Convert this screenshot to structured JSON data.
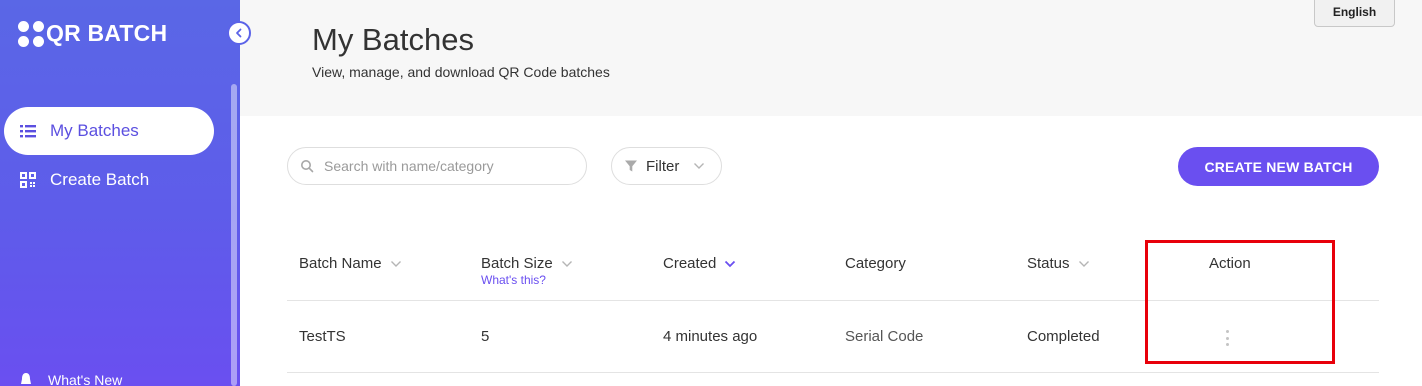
{
  "brand": {
    "name": "QR BATCH"
  },
  "sidebar": {
    "items": [
      {
        "label": "My Batches",
        "icon": "list-icon",
        "active": true
      },
      {
        "label": "Create Batch",
        "icon": "qr-code-icon",
        "active": false
      }
    ],
    "bottom": {
      "label": "What's New",
      "icon": "bell-icon"
    }
  },
  "header": {
    "language": "English",
    "title": "My Batches",
    "subtitle": "View, manage, and download QR Code batches"
  },
  "toolbar": {
    "search_placeholder": "Search with name/category",
    "filter_label": "Filter",
    "create_label": "CREATE NEW BATCH"
  },
  "table": {
    "columns": [
      {
        "label": "Batch Name",
        "sortable": true
      },
      {
        "label": "Batch Size",
        "sortable": true,
        "hint": "What's this?"
      },
      {
        "label": "Created",
        "sortable": true,
        "active_sort": true
      },
      {
        "label": "Category",
        "sortable": false
      },
      {
        "label": "Status",
        "sortable": true
      },
      {
        "label": "Action",
        "sortable": false
      }
    ],
    "rows": [
      {
        "batch_name": "TestTS",
        "batch_size": "5",
        "created": "4 minutes ago",
        "category": "Serial Code",
        "status": "Completed"
      }
    ]
  },
  "colors": {
    "accent": "#6a4ff0",
    "sidebar_gradient_top": "#5a67e6",
    "highlight": "#e8000a"
  }
}
